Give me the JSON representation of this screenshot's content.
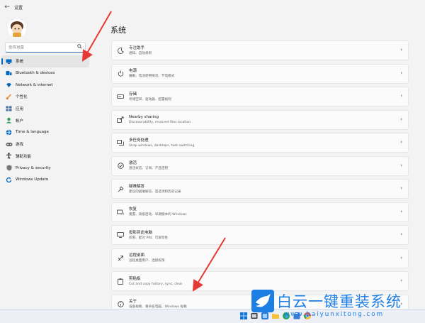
{
  "window": {
    "title": "设置",
    "back_glyph": "←"
  },
  "search": {
    "placeholder": "查找设置"
  },
  "nav": [
    {
      "key": "system",
      "label": "系统",
      "icon": "system-icon",
      "color": "#0067c0"
    },
    {
      "key": "bluetooth",
      "label": "Bluetooth & devices",
      "icon": "bluetooth-icon",
      "color": "#0067c0"
    },
    {
      "key": "network",
      "label": "Network & internet",
      "icon": "wifi-icon",
      "color": "#0067c0"
    },
    {
      "key": "personalization",
      "label": "个性化",
      "icon": "brush-icon",
      "color": "#e08a2e"
    },
    {
      "key": "apps",
      "label": "应用",
      "icon": "apps-icon",
      "color": "#4a6ea8"
    },
    {
      "key": "accounts",
      "label": "帐户",
      "icon": "account-icon",
      "color": "#2e9e5b"
    },
    {
      "key": "time",
      "label": "Time & language",
      "icon": "globe-icon",
      "color": "#0067c0"
    },
    {
      "key": "gaming",
      "label": "游戏",
      "icon": "game-icon",
      "color": "#555555"
    },
    {
      "key": "accessibility",
      "label": "辅助功能",
      "icon": "accessibility-icon",
      "color": "#1a1a1a"
    },
    {
      "key": "privacy",
      "label": "Privacy & security",
      "icon": "shield-icon",
      "color": "#666666"
    },
    {
      "key": "update",
      "label": "Windows Update",
      "icon": "update-icon",
      "color": "#0067c0"
    }
  ],
  "main": {
    "title": "系统",
    "cards": [
      {
        "key": "focus",
        "title": "专注助手",
        "desc": "通知、自动规则",
        "icon": "moon-icon"
      },
      {
        "key": "power",
        "title": "电源",
        "desc": "睡眠、电池使用情况、节电模式",
        "icon": "power-icon"
      },
      {
        "key": "storage",
        "title": "存储",
        "desc": "存储空间、驱动器、配置规则",
        "icon": "storage-icon"
      },
      {
        "key": "nearby",
        "title": "Nearby sharing",
        "desc": "Discoverability, received files location",
        "icon": "share-icon"
      },
      {
        "key": "multitask",
        "title": "多任务处理",
        "desc": "Snap windows, desktops, task switching",
        "icon": "multitask-icon"
      },
      {
        "key": "activation",
        "title": "激活",
        "desc": "激活状态、订阅、产品密钥",
        "icon": "check-circle-icon"
      },
      {
        "key": "troubleshoot",
        "title": "疑难解答",
        "desc": "建议的疑难解答、首选项和历史记录",
        "icon": "wrench-icon"
      },
      {
        "key": "recovery",
        "title": "恢复",
        "desc": "重置、高级启动、早期版本的 Windows",
        "icon": "recovery-icon"
      },
      {
        "key": "projection",
        "title": "投影到此电脑",
        "desc": "权限、配对 PIN、可发现性",
        "icon": "projector-icon"
      },
      {
        "key": "remote",
        "title": "远程桌面",
        "desc": "远程桌面用户、连接权限",
        "icon": "remote-icon"
      },
      {
        "key": "clipboard",
        "title": "剪贴板",
        "desc": "Cut and copy history, sync, clear",
        "icon": "clipboard-icon"
      },
      {
        "key": "about",
        "title": "关于",
        "desc": "设备规格、重命名电脑、Windows 规格",
        "icon": "info-icon"
      }
    ],
    "chevron": "›"
  },
  "watermark": {
    "brand": "白云一键重装系统",
    "url": "www.baiyunxitong.com"
  },
  "colors": {
    "accent": "#0067c0",
    "annotation_arrow": "#e53935",
    "watermark": "#1d7fe3"
  }
}
